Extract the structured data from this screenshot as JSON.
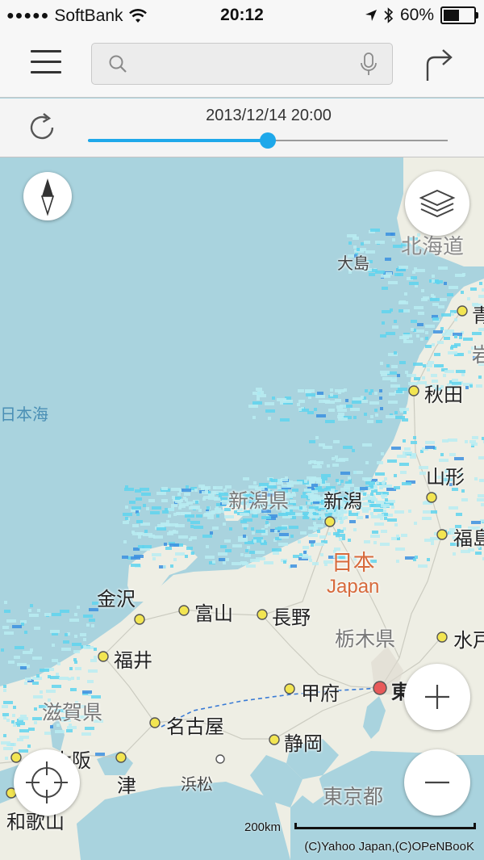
{
  "status": {
    "carrier": "SoftBank",
    "time": "20:12",
    "battery": "60%",
    "battery_level": 0.6
  },
  "nav": {
    "search_placeholder": "",
    "icons": [
      "menu-icon",
      "search-icon",
      "microphone-icon",
      "route-icon"
    ]
  },
  "timebar": {
    "datetime": "2013/12/14 20:00",
    "slider_value": 0.5,
    "accent_color": "#1ea8ea"
  },
  "map": {
    "labels": {
      "hokkaido": "北海道",
      "oshima": "大島",
      "aomori": "青",
      "iwate": "岩",
      "nihonkai": "日本海",
      "akita": "秋田",
      "yamagata": "山形",
      "niigata_pref": "新潟県",
      "niigata": "新潟",
      "fukushima": "福島",
      "nihon": "日本",
      "japan": "Japan",
      "kanazawa": "金沢",
      "toyama": "富山",
      "nagano": "長野",
      "tochigi_pref": "栃木県",
      "mito": "水戸",
      "fukui": "福井",
      "kofu": "甲府",
      "tokyo": "東京",
      "shiga_pref": "滋賀県",
      "nagoya": "名古屋",
      "shizuoka": "静岡",
      "osaka": "大阪",
      "tsu": "津",
      "hamamatsu": "浜松",
      "wakayama": "和歌山",
      "tokyo_pref": "東京都"
    },
    "scale_label": "200km",
    "copyright": "(C)Yahoo Japan,(C)OPeNBooK",
    "colors": {
      "sea": "#a9d3de",
      "land": "#eeeee4",
      "rain_light": "#b9ecf2",
      "rain_mid": "#5fd3ef",
      "rain_heavy": "#3b8fe0"
    }
  },
  "controls": [
    "compass-icon",
    "layers-icon",
    "locate-icon",
    "zoom-in-icon",
    "zoom-out-icon"
  ]
}
